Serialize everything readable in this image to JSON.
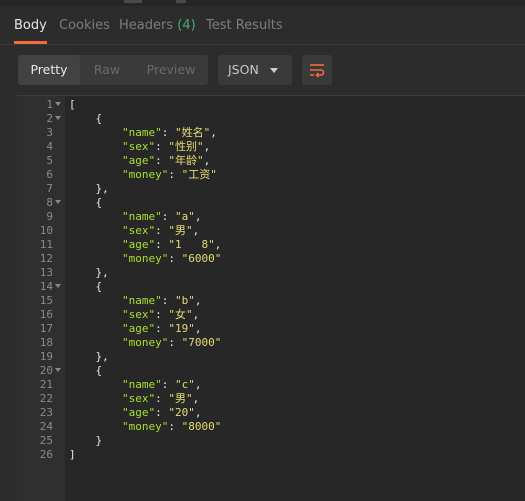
{
  "tabs": [
    {
      "label": "Body",
      "active": true
    },
    {
      "label": "Cookies"
    },
    {
      "label": "Headers",
      "count": "(4)"
    },
    {
      "label": "Test Results"
    }
  ],
  "view_modes": {
    "pretty": "Pretty",
    "raw": "Raw",
    "preview": "Preview"
  },
  "format_select": {
    "value": "JSON"
  },
  "wrap_button": {
    "icon": "wrap-lines-icon"
  },
  "colors": {
    "accent": "#f26b3a",
    "key": "#a6e22e",
    "string": "#e6db74",
    "count": "#3fae7a"
  },
  "code": {
    "lines": [
      {
        "n": "1",
        "fold": true,
        "indent": "",
        "kind": "punct",
        "text": "["
      },
      {
        "n": "2",
        "fold": true,
        "indent": "    ",
        "kind": "punct",
        "text": "{"
      },
      {
        "n": "3",
        "indent": "        ",
        "kind": "pair",
        "key": "\"name\"",
        "sep": ": ",
        "val": "\"姓名\"",
        "end": ","
      },
      {
        "n": "4",
        "indent": "        ",
        "kind": "pair",
        "key": "\"sex\"",
        "sep": ": ",
        "val": "\"性别\"",
        "end": ","
      },
      {
        "n": "5",
        "indent": "        ",
        "kind": "pair",
        "key": "\"age\"",
        "sep": ": ",
        "val": "\"年龄\"",
        "end": ","
      },
      {
        "n": "6",
        "indent": "        ",
        "kind": "pair",
        "key": "\"money\"",
        "sep": ": ",
        "val": "\"工资\"",
        "end": ""
      },
      {
        "n": "7",
        "indent": "    ",
        "kind": "punct",
        "text": "},"
      },
      {
        "n": "8",
        "fold": true,
        "indent": "    ",
        "kind": "punct",
        "text": "{"
      },
      {
        "n": "9",
        "indent": "        ",
        "kind": "pair",
        "key": "\"name\"",
        "sep": ": ",
        "val": "\"a\"",
        "end": ","
      },
      {
        "n": "10",
        "indent": "        ",
        "kind": "pair",
        "key": "\"sex\"",
        "sep": ": ",
        "val": "\"男\"",
        "end": ","
      },
      {
        "n": "11",
        "indent": "        ",
        "kind": "pair",
        "key": "\"age\"",
        "sep": ": ",
        "val": "\"1   8\"",
        "end": ","
      },
      {
        "n": "12",
        "indent": "        ",
        "kind": "pair",
        "key": "\"money\"",
        "sep": ": ",
        "val": "\"6000\"",
        "end": ""
      },
      {
        "n": "13",
        "indent": "    ",
        "kind": "punct",
        "text": "},"
      },
      {
        "n": "14",
        "fold": true,
        "indent": "    ",
        "kind": "punct",
        "text": "{"
      },
      {
        "n": "15",
        "indent": "        ",
        "kind": "pair",
        "key": "\"name\"",
        "sep": ": ",
        "val": "\"b\"",
        "end": ","
      },
      {
        "n": "16",
        "indent": "        ",
        "kind": "pair",
        "key": "\"sex\"",
        "sep": ": ",
        "val": "\"女\"",
        "end": ","
      },
      {
        "n": "17",
        "indent": "        ",
        "kind": "pair",
        "key": "\"age\"",
        "sep": ": ",
        "val": "\"19\"",
        "end": ","
      },
      {
        "n": "18",
        "indent": "        ",
        "kind": "pair",
        "key": "\"money\"",
        "sep": ": ",
        "val": "\"7000\"",
        "end": ""
      },
      {
        "n": "19",
        "indent": "    ",
        "kind": "punct",
        "text": "},"
      },
      {
        "n": "20",
        "fold": true,
        "indent": "    ",
        "kind": "punct",
        "text": "{"
      },
      {
        "n": "21",
        "indent": "        ",
        "kind": "pair",
        "key": "\"name\"",
        "sep": ": ",
        "val": "\"c\"",
        "end": ","
      },
      {
        "n": "22",
        "indent": "        ",
        "kind": "pair",
        "key": "\"sex\"",
        "sep": ": ",
        "val": "\"男\"",
        "end": ","
      },
      {
        "n": "23",
        "indent": "        ",
        "kind": "pair",
        "key": "\"age\"",
        "sep": ": ",
        "val": "\"20\"",
        "end": ","
      },
      {
        "n": "24",
        "indent": "        ",
        "kind": "pair",
        "key": "\"money\"",
        "sep": ": ",
        "val": "\"8000\"",
        "end": ""
      },
      {
        "n": "25",
        "indent": "    ",
        "kind": "punct",
        "text": "}"
      },
      {
        "n": "26",
        "indent": "",
        "kind": "punct",
        "text": "]"
      }
    ]
  }
}
